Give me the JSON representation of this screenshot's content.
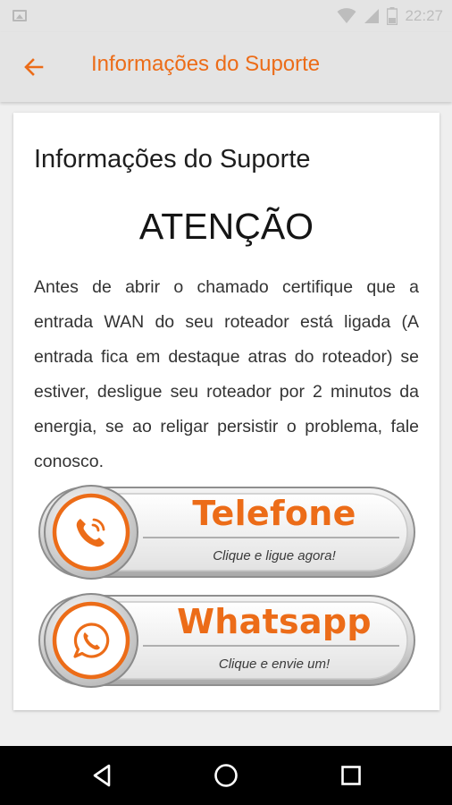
{
  "status_bar": {
    "time": "22:27",
    "icons": [
      "image-icon",
      "wifi-icon",
      "signal-icon",
      "battery-icon"
    ]
  },
  "app_bar": {
    "title": "Informações do Suporte",
    "back_icon": "arrow-left-icon"
  },
  "content": {
    "title": "Informações do Suporte",
    "attention": "ATENÇÃO",
    "notice": "Antes de abrir o chamado certifique que a entrada WAN do seu roteador está ligada (A entrada fica em destaque atras do roteador) se estiver, desligue seu roteador por 2 minutos da energia, se ao religar persistir o problema, fale conosco."
  },
  "buttons": [
    {
      "label": "Telefone",
      "sublabel": "Clique e ligue agora!",
      "icon": "phone-icon"
    },
    {
      "label": "Whatsapp",
      "sublabel": "Clique e envie um!",
      "icon": "whatsapp-icon"
    }
  ],
  "nav_bar": {
    "icons": [
      "back-triangle-icon",
      "home-circle-icon",
      "recents-square-icon"
    ]
  },
  "colors": {
    "accent": "#ec6c18",
    "app_bar": "#e4e4e4",
    "nav_bar": "#000000"
  }
}
